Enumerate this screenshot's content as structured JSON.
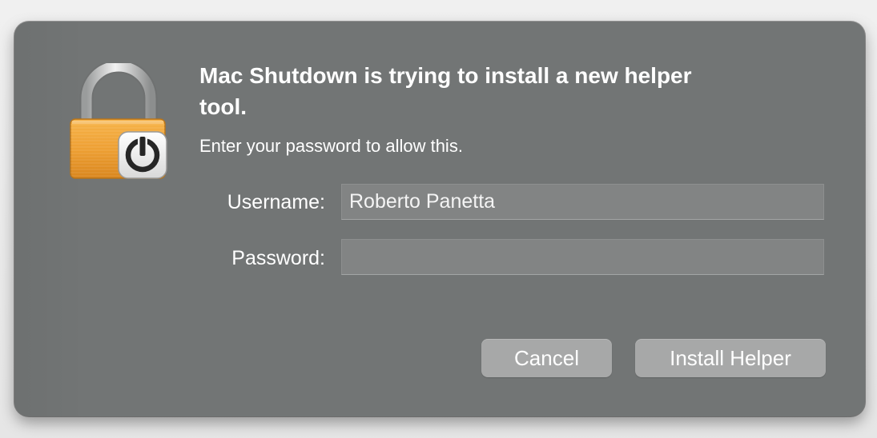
{
  "dialog": {
    "title": "Mac Shutdown is trying to install a new helper tool.",
    "message": "Enter your password to allow this.",
    "icon": "lock-with-power-badge-icon",
    "username_label": "Username:",
    "username_value": "Roberto Panetta",
    "password_label": "Password:",
    "password_value": "",
    "cancel_label": "Cancel",
    "install_label": "Install Helper"
  },
  "colors": {
    "dialog_bg": "#727575",
    "field_bg": "#828484",
    "button_bg": "#a7a8a8",
    "lock_body": "#f0a53a",
    "text": "#ffffff"
  }
}
